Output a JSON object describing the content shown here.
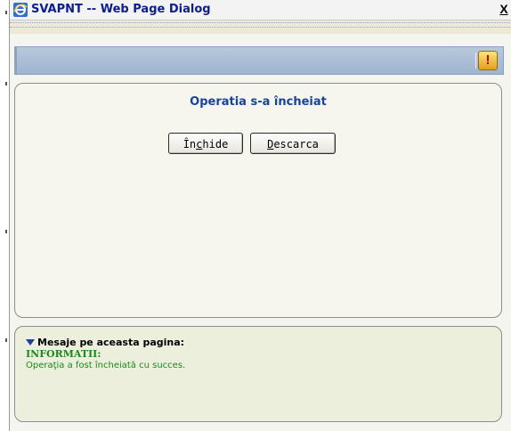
{
  "window": {
    "title": "SVAPNT -- Web Page Dialog",
    "close_glyph": "X"
  },
  "header": {
    "alert_icon": "exclamation-icon",
    "alert_glyph": "!"
  },
  "main": {
    "operation_title": "Operatia s-a încheiat",
    "buttons": {
      "close": {
        "label_prefix": "În",
        "hotkey": "c",
        "label_suffix": "hide"
      },
      "download": {
        "hotkey": "D",
        "label_suffix": "escarca"
      }
    }
  },
  "messages": {
    "header": "Mesaje pe aceasta pagina:",
    "info_label": "INFORMATII:",
    "info_text": "Operaţia a fost încheiată cu succes."
  },
  "colors": {
    "title_blue": "#0b1f8a",
    "heading_blue": "#15449a",
    "info_green": "#1a8a1a",
    "header_bar": "#a8bbd5"
  }
}
